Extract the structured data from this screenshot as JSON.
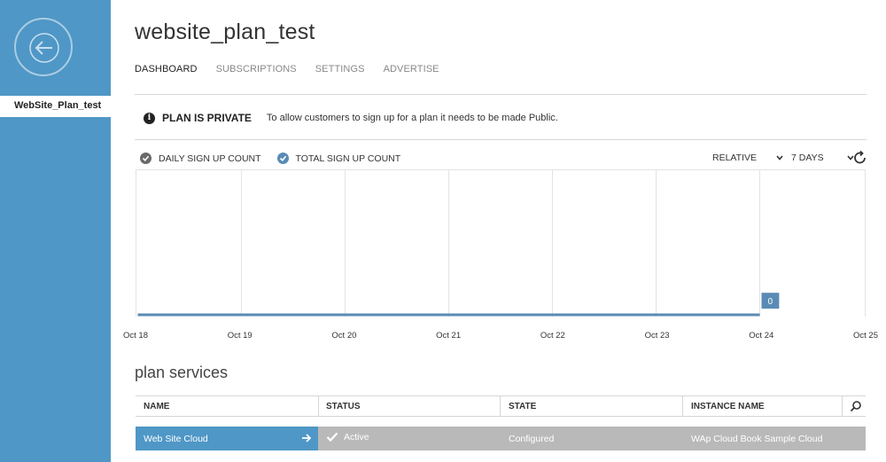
{
  "sidebar": {
    "back_icon": "back-arrow-icon",
    "active_item": "WebSite_Plan_test"
  },
  "header": {
    "title": "website_plan_test",
    "tabs": [
      {
        "label": "DASHBOARD",
        "active": true
      },
      {
        "label": "SUBSCRIPTIONS",
        "active": false
      },
      {
        "label": "SETTINGS",
        "active": false
      },
      {
        "label": "ADVERTISE",
        "active": false
      }
    ]
  },
  "notice": {
    "icon": "info-icon",
    "label": "PLAN IS PRIVATE",
    "text": "To allow customers to sign up for a plan it needs to be made Public."
  },
  "chart_controls": {
    "legend": [
      {
        "label": "DAILY SIGN UP COUNT",
        "color": "#6a6a6a"
      },
      {
        "label": "TOTAL SIGN UP COUNT",
        "color": "#5a8bb5"
      }
    ],
    "mode": "RELATIVE",
    "range": "7 DAYS"
  },
  "chart_data": {
    "type": "line",
    "x": [
      "Oct 18",
      "Oct 19",
      "Oct 20",
      "Oct 21",
      "Oct 22",
      "Oct 23",
      "Oct 24",
      "Oct 25"
    ],
    "series": [
      {
        "name": "TOTAL SIGN UP COUNT",
        "values": [
          0,
          0,
          0,
          0,
          0,
          0,
          0
        ],
        "color": "#5a8bb5"
      }
    ],
    "last_value_label": "0",
    "grid": true
  },
  "services": {
    "title": "plan services",
    "columns": [
      "NAME",
      "STATUS",
      "STATE",
      "INSTANCE NAME"
    ],
    "rows": [
      {
        "name": "Web Site Cloud",
        "status": "Active",
        "state": "Configured",
        "instance": "WAp Cloud Book Sample Cloud"
      }
    ],
    "colors": {
      "selected": "#4f97c6",
      "row": "#b9b9b9"
    }
  }
}
